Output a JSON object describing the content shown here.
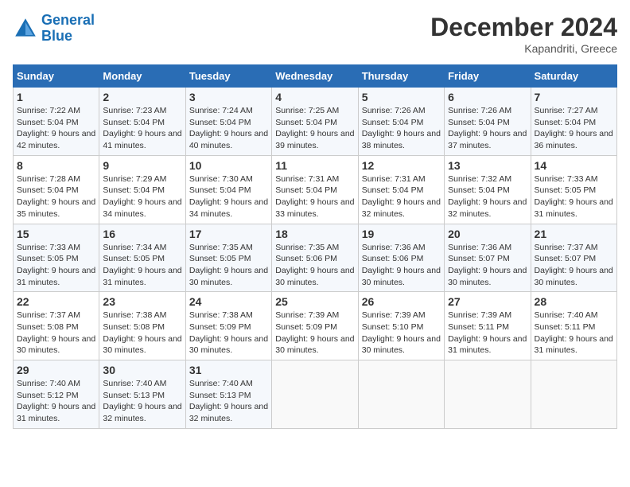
{
  "logo": {
    "line1": "General",
    "line2": "Blue"
  },
  "title": "December 2024",
  "location": "Kapandriti, Greece",
  "days_of_week": [
    "Sunday",
    "Monday",
    "Tuesday",
    "Wednesday",
    "Thursday",
    "Friday",
    "Saturday"
  ],
  "weeks": [
    [
      {
        "day": "1",
        "sunrise": "7:22 AM",
        "sunset": "5:04 PM",
        "daylight": "9 hours and 42 minutes."
      },
      {
        "day": "2",
        "sunrise": "7:23 AM",
        "sunset": "5:04 PM",
        "daylight": "9 hours and 41 minutes."
      },
      {
        "day": "3",
        "sunrise": "7:24 AM",
        "sunset": "5:04 PM",
        "daylight": "9 hours and 40 minutes."
      },
      {
        "day": "4",
        "sunrise": "7:25 AM",
        "sunset": "5:04 PM",
        "daylight": "9 hours and 39 minutes."
      },
      {
        "day": "5",
        "sunrise": "7:26 AM",
        "sunset": "5:04 PM",
        "daylight": "9 hours and 38 minutes."
      },
      {
        "day": "6",
        "sunrise": "7:26 AM",
        "sunset": "5:04 PM",
        "daylight": "9 hours and 37 minutes."
      },
      {
        "day": "7",
        "sunrise": "7:27 AM",
        "sunset": "5:04 PM",
        "daylight": "9 hours and 36 minutes."
      }
    ],
    [
      {
        "day": "8",
        "sunrise": "7:28 AM",
        "sunset": "5:04 PM",
        "daylight": "9 hours and 35 minutes."
      },
      {
        "day": "9",
        "sunrise": "7:29 AM",
        "sunset": "5:04 PM",
        "daylight": "9 hours and 34 minutes."
      },
      {
        "day": "10",
        "sunrise": "7:30 AM",
        "sunset": "5:04 PM",
        "daylight": "9 hours and 34 minutes."
      },
      {
        "day": "11",
        "sunrise": "7:31 AM",
        "sunset": "5:04 PM",
        "daylight": "9 hours and 33 minutes."
      },
      {
        "day": "12",
        "sunrise": "7:31 AM",
        "sunset": "5:04 PM",
        "daylight": "9 hours and 32 minutes."
      },
      {
        "day": "13",
        "sunrise": "7:32 AM",
        "sunset": "5:04 PM",
        "daylight": "9 hours and 32 minutes."
      },
      {
        "day": "14",
        "sunrise": "7:33 AM",
        "sunset": "5:05 PM",
        "daylight": "9 hours and 31 minutes."
      }
    ],
    [
      {
        "day": "15",
        "sunrise": "7:33 AM",
        "sunset": "5:05 PM",
        "daylight": "9 hours and 31 minutes."
      },
      {
        "day": "16",
        "sunrise": "7:34 AM",
        "sunset": "5:05 PM",
        "daylight": "9 hours and 31 minutes."
      },
      {
        "day": "17",
        "sunrise": "7:35 AM",
        "sunset": "5:05 PM",
        "daylight": "9 hours and 30 minutes."
      },
      {
        "day": "18",
        "sunrise": "7:35 AM",
        "sunset": "5:06 PM",
        "daylight": "9 hours and 30 minutes."
      },
      {
        "day": "19",
        "sunrise": "7:36 AM",
        "sunset": "5:06 PM",
        "daylight": "9 hours and 30 minutes."
      },
      {
        "day": "20",
        "sunrise": "7:36 AM",
        "sunset": "5:07 PM",
        "daylight": "9 hours and 30 minutes."
      },
      {
        "day": "21",
        "sunrise": "7:37 AM",
        "sunset": "5:07 PM",
        "daylight": "9 hours and 30 minutes."
      }
    ],
    [
      {
        "day": "22",
        "sunrise": "7:37 AM",
        "sunset": "5:08 PM",
        "daylight": "9 hours and 30 minutes."
      },
      {
        "day": "23",
        "sunrise": "7:38 AM",
        "sunset": "5:08 PM",
        "daylight": "9 hours and 30 minutes."
      },
      {
        "day": "24",
        "sunrise": "7:38 AM",
        "sunset": "5:09 PM",
        "daylight": "9 hours and 30 minutes."
      },
      {
        "day": "25",
        "sunrise": "7:39 AM",
        "sunset": "5:09 PM",
        "daylight": "9 hours and 30 minutes."
      },
      {
        "day": "26",
        "sunrise": "7:39 AM",
        "sunset": "5:10 PM",
        "daylight": "9 hours and 30 minutes."
      },
      {
        "day": "27",
        "sunrise": "7:39 AM",
        "sunset": "5:11 PM",
        "daylight": "9 hours and 31 minutes."
      },
      {
        "day": "28",
        "sunrise": "7:40 AM",
        "sunset": "5:11 PM",
        "daylight": "9 hours and 31 minutes."
      }
    ],
    [
      {
        "day": "29",
        "sunrise": "7:40 AM",
        "sunset": "5:12 PM",
        "daylight": "9 hours and 31 minutes."
      },
      {
        "day": "30",
        "sunrise": "7:40 AM",
        "sunset": "5:13 PM",
        "daylight": "9 hours and 32 minutes."
      },
      {
        "day": "31",
        "sunrise": "7:40 AM",
        "sunset": "5:13 PM",
        "daylight": "9 hours and 32 minutes."
      },
      null,
      null,
      null,
      null
    ]
  ]
}
